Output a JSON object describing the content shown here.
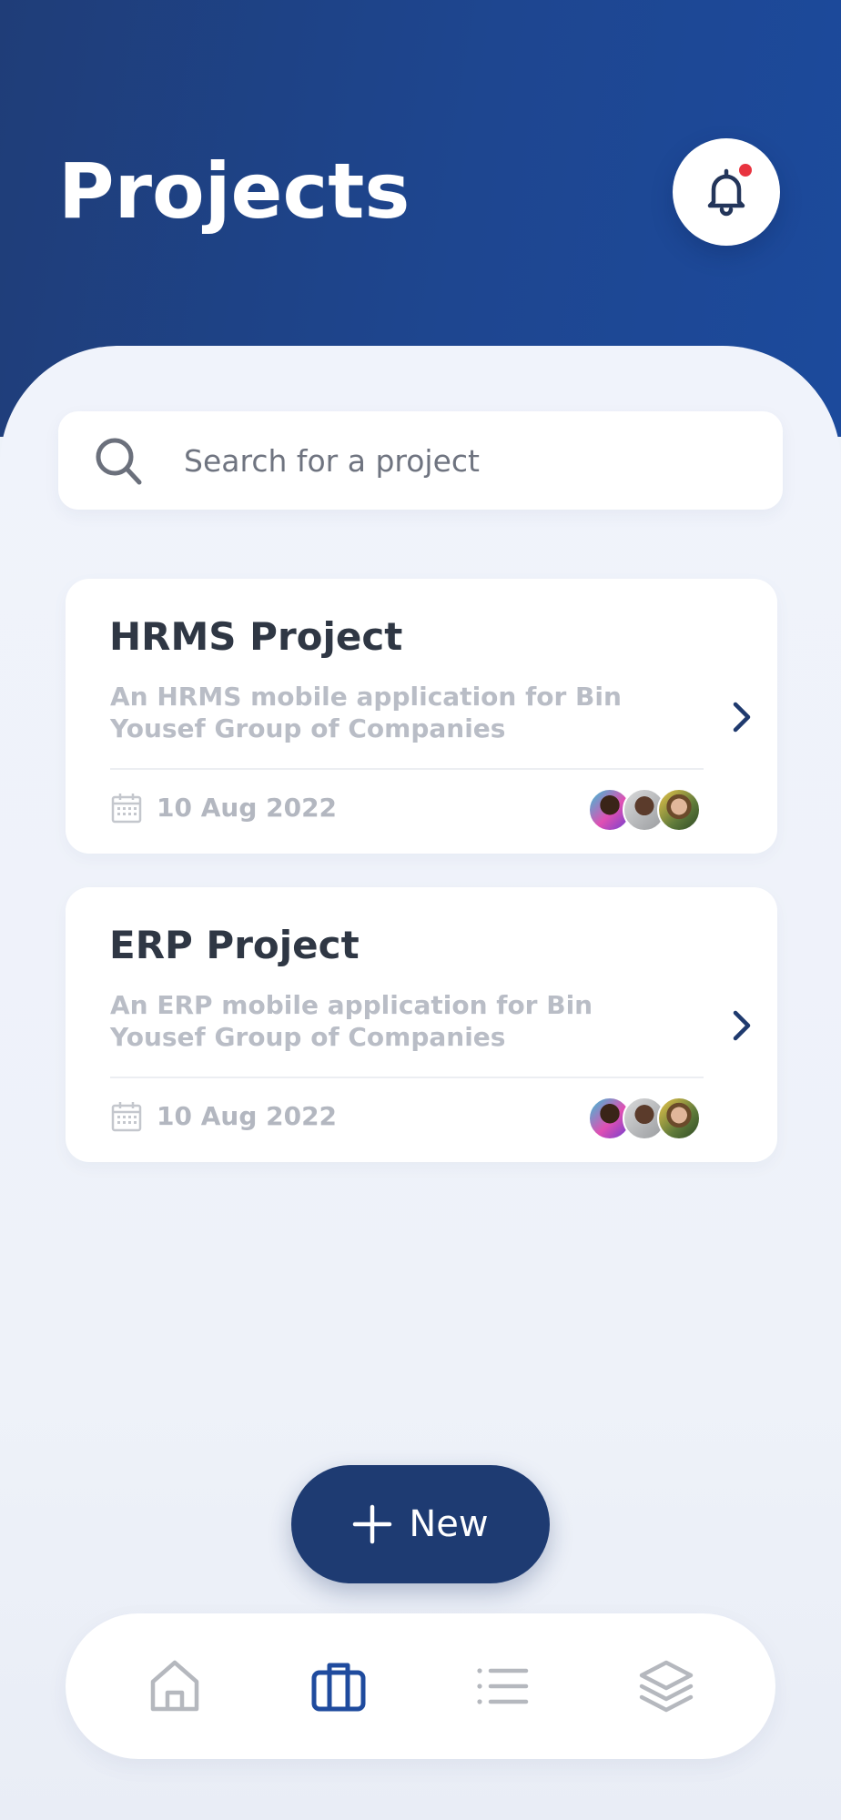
{
  "header": {
    "title": "Projects",
    "notification_icon": "bell-icon",
    "has_unread": true
  },
  "search": {
    "placeholder": "Search for a project",
    "value": "",
    "icon": "search-icon"
  },
  "projects": [
    {
      "title": "HRMS Project",
      "description": "An HRMS mobile application for Bin Yousef Group of Companies",
      "date": "10 Aug 2022",
      "member_count": 3
    },
    {
      "title": "ERP Project",
      "description": "An ERP mobile application for Bin Yousef Group of Companies",
      "date": "10 Aug 2022",
      "member_count": 3
    }
  ],
  "fab": {
    "label": "New",
    "icon": "plus-icon"
  },
  "bottom_nav": {
    "items": [
      "home-icon",
      "briefcase-icon",
      "list-icon",
      "layers-icon"
    ],
    "active": "briefcase-icon"
  },
  "colors": {
    "primary": "#1e3b72",
    "header_gradient_start": "#1f3d78",
    "header_gradient_end": "#1c4a9c",
    "accent_dot": "#e8333f",
    "nav_active": "#1f4b9e",
    "nav_inactive": "#b5b8be"
  }
}
